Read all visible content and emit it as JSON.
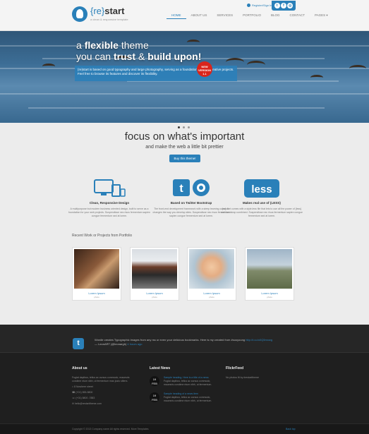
{
  "header": {
    "logo_brace": "{re}",
    "logo_word": "start",
    "tagline": "a clean & responsive template",
    "nav": [
      "HOME",
      "ABOUT US",
      "SERVICES",
      "PORTFOLIO",
      "BLOG",
      "CONTACT",
      "PAGES ▾"
    ],
    "signin": "Register/Sign In",
    "social_icons": [
      "twitter-icon",
      "facebook-icon",
      "dribbble-icon"
    ]
  },
  "hero": {
    "line1_pre": "a ",
    "line1_bold": "flexible",
    "line1_post": " theme",
    "line2_pre": "you can ",
    "line2_bold1": "trust",
    "line2_mid": " & ",
    "line2_bold2": "build upon!",
    "box_text": "{re}start is based on good typography and large photography, serving as a foundation for your creative projects. Feel free to browse its features and discover its flexibility.",
    "badge": "NEW VERSION 1.1"
  },
  "intro": {
    "heading": "focus on what's important",
    "subheading": "and make the web a little bit prettier",
    "button": "Buy this theme!"
  },
  "features": [
    {
      "title": "Clean, Responsive Design",
      "desc": "A multipurpose but modern business oriented design, built to serve as a foundation for your web projects. Suspendisse nec risus fermentum sapien congue fermentum sed at lorem."
    },
    {
      "title": "Based on Twitter Bootstrap",
      "desc": "The front-end development framework with a steep learning curve. It changes the way you develop sites. Suspendisse nec risus fermentum sapien congue fermentum sed at lorem."
    },
    {
      "title": "Makes real use of {LESS}",
      "desc": "{re}start comes with a style.less file that lets to use all the power of {less} and bootstrap combined. Suspendisse nec risus fermentum sapien congue fermentum sed at lorem."
    }
  ],
  "recent": {
    "heading": "Recent Work or Projects from Portfolio",
    "items": [
      {
        "title": "Lorem Ipsum",
        "sub": "photo"
      },
      {
        "title": "Lorem Ipsum",
        "sub": "photo"
      },
      {
        "title": "Lorem Ipsum",
        "sub": "photo"
      },
      {
        "title": "Lorem Ipsum",
        "sub": "photo"
      }
    ]
  },
  "footer": {
    "tweet": "Wordle creates Typographic images from any rss or even your delicious bookmarks. Here is my created from #sooyoung",
    "tweet_link": "http://t.co/o0Q5mxwg",
    "tweet_by": "— LeonART (@leonargh)",
    "tweet_time": "4 hours ago",
    "about_title": "About us",
    "about_text": "Fugiat dapibus, tellus ac cursus commodo, mauesris condime ntum nibh, ut fermentum mas justo sitters.",
    "address": "8 Nowhere street",
    "phone": "(+01) 555-5800",
    "fax": "(+01) 5800 -7883",
    "email": "hello@restarttheme.com",
    "news_title": "Latest News",
    "news": [
      {
        "day": "19",
        "month": "FEB",
        "link": "Sample heading. Here is a title of a news",
        "text": "Fugiat dapibus, tellus ac cursus commodo, mauesris condime ntum nibh, ut fermentum."
      },
      {
        "day": "19",
        "month": "FEB",
        "link": "Sample heading of a news item",
        "text": "Fugiat dapibus, tellus ac cursus commodo, mauesris condime ntum nibh, ut fermentum."
      }
    ],
    "flickr_title": "FlickrFeed",
    "flickr_text": "No photos fit by #restarttheme",
    "copyright": "Copyright © 2013 Company name All rights reserved. More Templates",
    "back_top": "Back top"
  },
  "colors": {
    "accent": "#2a80b9",
    "footer": "#1f1f1f",
    "badge": "#d9251c"
  }
}
